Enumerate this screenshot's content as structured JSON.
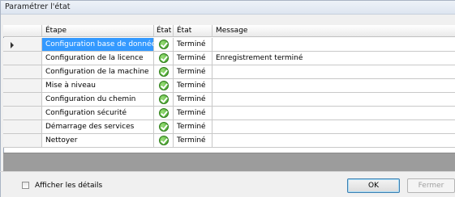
{
  "window": {
    "title": "Paramétrer l'état"
  },
  "grid": {
    "columns": {
      "step": "Étape",
      "status_icon": "État",
      "status": "État",
      "message": "Message"
    },
    "rows": [
      {
        "step": "Configuration base de données",
        "status": "Terminé",
        "message": "",
        "selected": true
      },
      {
        "step": "Configuration de la licence",
        "status": "Terminé",
        "message": "Enregistrement terminé"
      },
      {
        "step": "Configuration de la machine",
        "status": "Terminé",
        "message": ""
      },
      {
        "step": "Mise à niveau",
        "status": "Terminé",
        "message": ""
      },
      {
        "step": "Configuration du chemin",
        "status": "Terminé",
        "message": ""
      },
      {
        "step": "Configuration sécurité",
        "status": "Terminé",
        "message": ""
      },
      {
        "step": "Démarrage des services",
        "status": "Terminé",
        "message": ""
      },
      {
        "step": "Nettoyer",
        "status": "Terminé",
        "message": ""
      }
    ],
    "status_icon_name": "green-check-icon",
    "selected_row_color": "#3399ff"
  },
  "footer": {
    "show_details_label": "Afficher les détails",
    "show_details_checked": false,
    "ok_label": "OK",
    "close_label": "Fermer"
  }
}
